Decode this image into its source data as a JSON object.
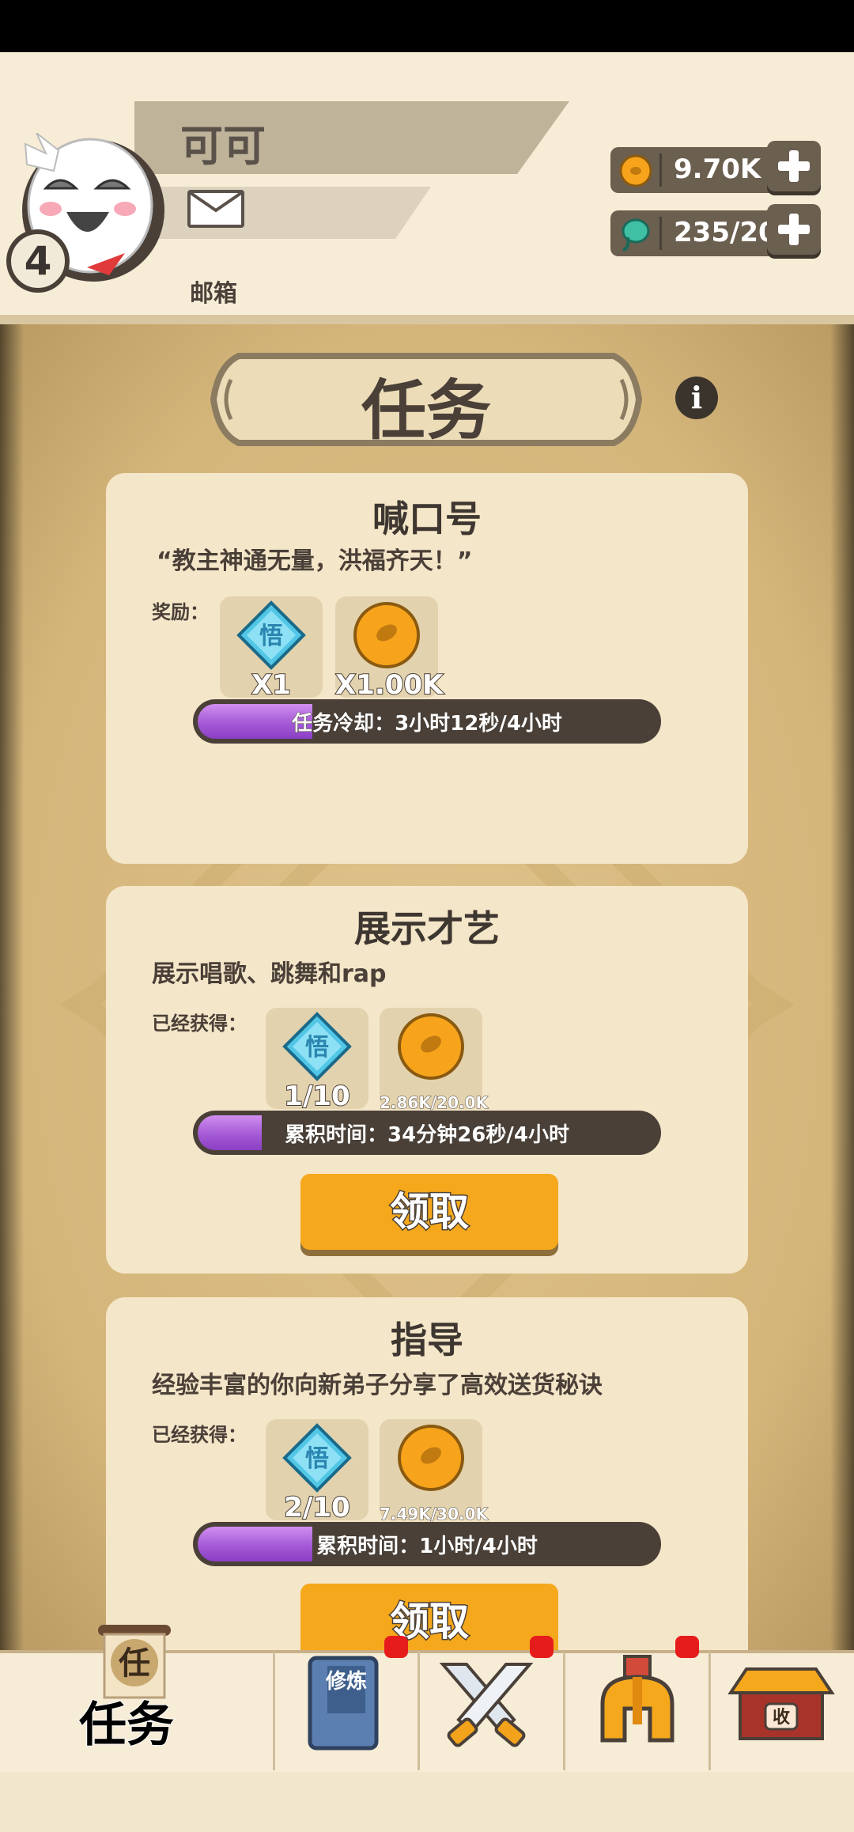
{
  "player": {
    "name": "可可",
    "level": "4",
    "mail_label": "邮箱"
  },
  "currencies": [
    {
      "icon": "coin-icon",
      "value": "9.70K"
    },
    {
      "icon": "spirit-gem-icon",
      "value": "235/20"
    }
  ],
  "page": {
    "title": "任务"
  },
  "tasks": [
    {
      "title": "喊口号",
      "desc": "“教主神通无量，洪福齐天！”",
      "reward_label": "奖励：",
      "items": [
        {
          "icon": "wu-gem-icon",
          "qty": "X1"
        },
        {
          "icon": "coin-icon",
          "qty": "X1.00K"
        }
      ],
      "progress_text": "任务冷却：3小时12秒/4小时",
      "progress_fraction": 0.25
    },
    {
      "title": "展示才艺",
      "desc": "展示唱歌、跳舞和rap",
      "reward_label": "已经获得：",
      "items": [
        {
          "icon": "wu-gem-icon",
          "qty": "1/10"
        },
        {
          "icon": "coin-icon",
          "qty": "2.86K/20.0K"
        }
      ],
      "progress_text": "累积时间：34分钟26秒/4小时",
      "progress_fraction": 0.14,
      "button": "领取"
    },
    {
      "title": "指导",
      "desc": "经验丰富的你向新弟子分享了高效送货秘诀",
      "reward_label": "已经获得：",
      "items": [
        {
          "icon": "wu-gem-icon",
          "qty": "2/10"
        },
        {
          "icon": "coin-icon",
          "qty": "7.49K/30.0K"
        }
      ],
      "progress_text": "累积时间：1小时/4小时",
      "progress_fraction": 0.25,
      "button": "领取"
    }
  ],
  "gem_glyph": "悟",
  "tabs": [
    {
      "label": "任务",
      "icon_text": "任",
      "active": true
    },
    {
      "icon": "cultivation-book-icon",
      "icon_text": "修炼",
      "badge": true
    },
    {
      "icon": "crossed-swords-icon",
      "badge": true
    },
    {
      "icon": "helmet-icon",
      "badge": true
    },
    {
      "icon": "shop-icon",
      "icon_text": "收"
    }
  ]
}
